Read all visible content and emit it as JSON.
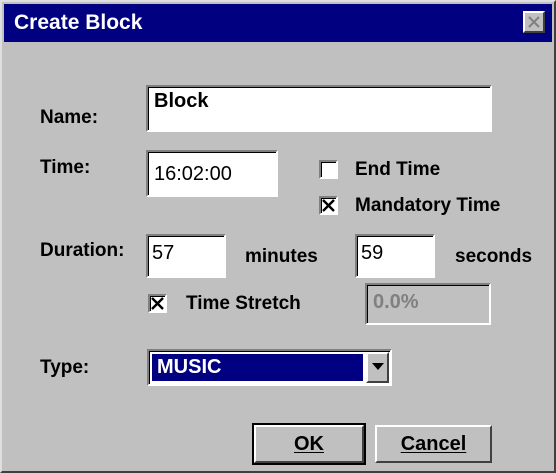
{
  "window": {
    "title": "Create Block"
  },
  "name": {
    "label": "Name:",
    "value": "Block"
  },
  "time": {
    "label": "Time:",
    "value": "16:02:00"
  },
  "end_time": {
    "label": "End Time",
    "checked": false
  },
  "mandatory_time": {
    "label": "Mandatory Time",
    "checked": true
  },
  "duration": {
    "label": "Duration:",
    "minutes_value": "57",
    "minutes_label": "minutes",
    "seconds_value": "59",
    "seconds_label": "seconds"
  },
  "time_stretch": {
    "label": "Time Stretch",
    "checked": true,
    "value": "0.0%"
  },
  "type": {
    "label": "Type:",
    "selected": "MUSIC"
  },
  "buttons": {
    "ok": "OK",
    "cancel": "Cancel"
  },
  "colors": {
    "titlebar": "#000080",
    "face": "#c0c0c0",
    "selection": "#000080"
  }
}
